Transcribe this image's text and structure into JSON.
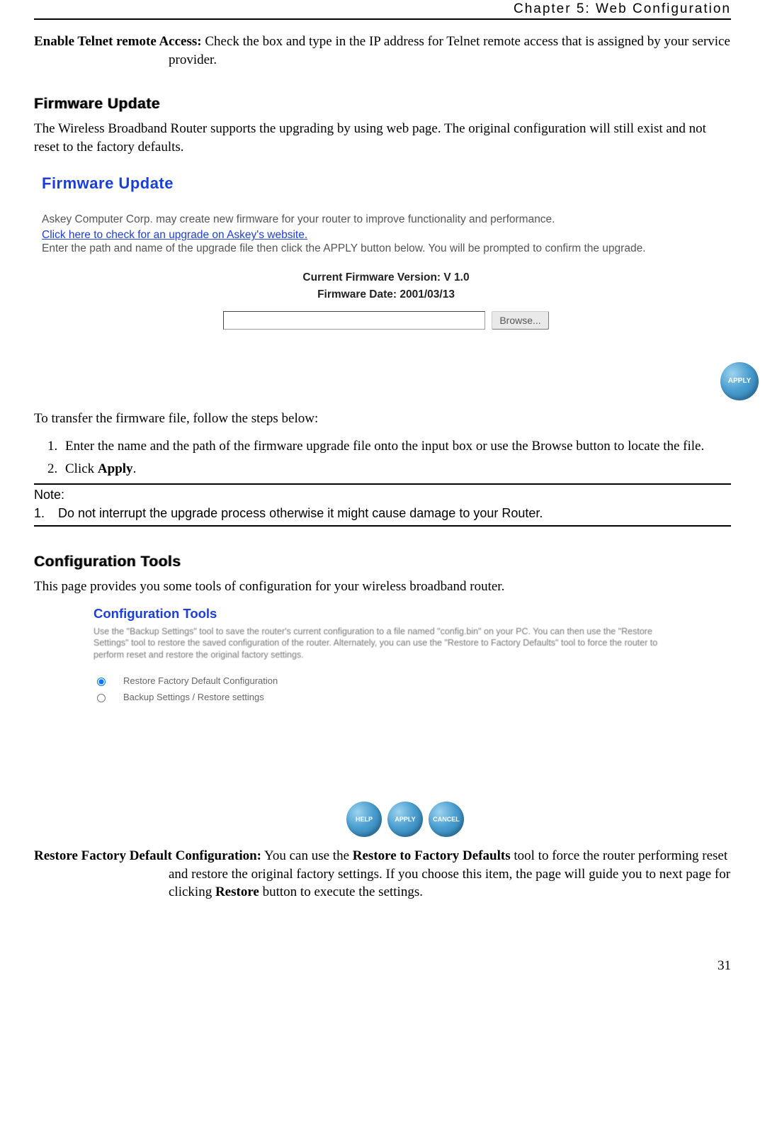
{
  "header": "Chapter 5: Web Configuration",
  "telnet": {
    "label": "Enable Telnet remote Access:",
    "text": " Check the box and type in the IP address for Telnet remote access that is assigned by your service provider."
  },
  "firmware": {
    "heading": "Firmware Update",
    "intro": "The Wireless Broadband Router supports the upgrading by using web page. The original configuration will still exist and not reset to the factory defaults.",
    "panel": {
      "title": "Firmware Update",
      "line1": "Askey Computer Corp. may create new firmware for your router to improve functionality and performance.",
      "link": "Click here to check for an upgrade on Askey's website.",
      "line2": "Enter the path and name of the upgrade file then click the APPLY button below. You will be prompted to confirm the upgrade.",
      "ver_label": "Current Firmware Version: ",
      "ver_value": "V 1.0",
      "date_label": "Firmware Date:  ",
      "date_value": "2001/03/13",
      "browse": "Browse...",
      "apply": "APPLY"
    },
    "steps_intro": "To transfer the firmware file, follow the steps below:",
    "step1": "Enter the name and the path of the firmware upgrade file onto the input box or use the Browse button to locate the file.",
    "step2_a": "Click ",
    "step2_b": "Apply",
    "step2_c": "."
  },
  "note": {
    "title": "Note:",
    "num": "1.",
    "text": "Do not interrupt the upgrade process otherwise it might cause damage to your Router."
  },
  "config": {
    "heading": "Configuration Tools",
    "intro": "This page provides you some tools of configuration for your wireless broadband router.",
    "panel": {
      "title": "Configuration Tools",
      "desc": "Use the \"Backup Settings\" tool to save the router's current configuration to a file named \"config.bin\" on your PC. You can then use the \"Restore Settings\" tool to restore the saved configuration of the router. Alternately, you can use the \"Restore to Factory Defaults\" tool to force the router to perform reset and restore the original factory settings.",
      "opt1": "Restore Factory Default Configuration",
      "opt2": "Backup Settings  / Restore settings",
      "help": "HELP",
      "apply": "APPLY",
      "cancel": "CANCEL"
    },
    "restore_label": "Restore Factory Default Configuration:",
    "restore_a": " You can use the ",
    "restore_b": "Restore to Factory Defaults",
    "restore_c": " tool to force the router performing reset and restore the original factory settings. If you choose this item, the page will guide you to next page for clicking ",
    "restore_d": "Restore",
    "restore_e": " button to execute the settings."
  },
  "page_number": "31"
}
